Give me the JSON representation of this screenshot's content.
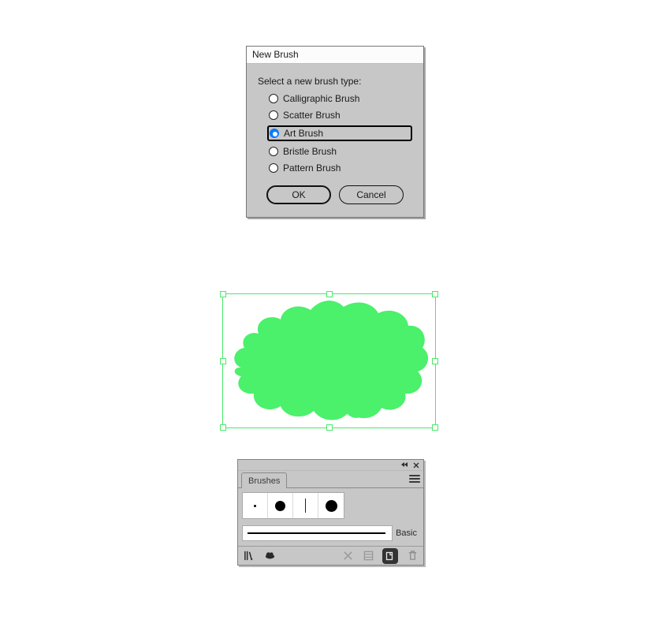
{
  "dialog": {
    "title": "New Brush",
    "prompt": "Select a new brush type:",
    "options": {
      "calligraphic": "Calligraphic Brush",
      "scatter": "Scatter Brush",
      "art": "Art Brush",
      "bristle": "Bristle Brush",
      "pattern": "Pattern Brush"
    },
    "selected": "art",
    "ok_label": "OK",
    "cancel_label": "Cancel"
  },
  "canvas": {
    "selection_color": "#49e96b",
    "blob_fill": "#4BF06B"
  },
  "brushes_panel": {
    "tab_label": "Brushes",
    "basic_label": "Basic"
  }
}
